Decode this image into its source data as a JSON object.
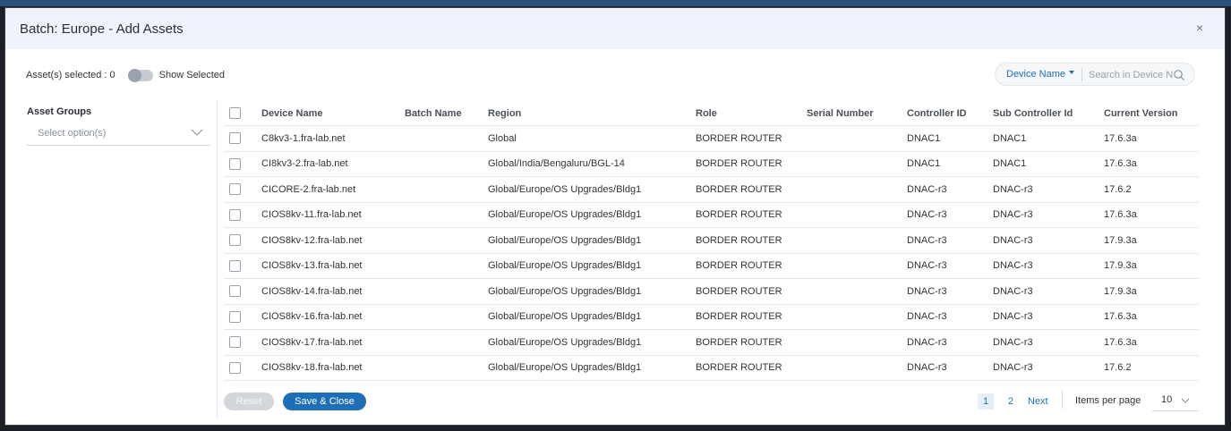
{
  "modal": {
    "title": "Batch: Europe - Add Assets",
    "close": "×"
  },
  "selection": {
    "count_label": "Asset(s) selected : 0",
    "toggle_label": "Show Selected",
    "toggle_on": false
  },
  "search": {
    "field": "Device Name",
    "placeholder": "Search in Device Na"
  },
  "asset_groups": {
    "title": "Asset Groups",
    "placeholder": "Select option(s)"
  },
  "table": {
    "columns": [
      "Device Name",
      "Batch Name",
      "Region",
      "Role",
      "Serial Number",
      "Controller ID",
      "Sub Controller Id",
      "Current Version"
    ],
    "rows": [
      {
        "device": "C8kv3-1.fra-lab.net",
        "batch": "",
        "region": "Global",
        "role": "BORDER ROUTER",
        "serial": "",
        "controller": "DNAC1",
        "sub": "DNAC1",
        "version": "17.6.3a"
      },
      {
        "device": "CI8kv3-2.fra-lab.net",
        "batch": "",
        "region": "Global/India/Bengaluru/BGL-14",
        "role": "BORDER ROUTER",
        "serial": "",
        "controller": "DNAC1",
        "sub": "DNAC1",
        "version": "17.6.3a"
      },
      {
        "device": "CICORE-2.fra-lab.net",
        "batch": "",
        "region": "Global/Europe/OS Upgrades/Bldg1",
        "role": "BORDER ROUTER",
        "serial": "",
        "controller": "DNAC-r3",
        "sub": "DNAC-r3",
        "version": "17.6.2"
      },
      {
        "device": "CIOS8kv-11.fra-lab.net",
        "batch": "",
        "region": "Global/Europe/OS Upgrades/Bldg1",
        "role": "BORDER ROUTER",
        "serial": "",
        "controller": "DNAC-r3",
        "sub": "DNAC-r3",
        "version": "17.6.3a"
      },
      {
        "device": "CIOS8kv-12.fra-lab.net",
        "batch": "",
        "region": "Global/Europe/OS Upgrades/Bldg1",
        "role": "BORDER ROUTER",
        "serial": "",
        "controller": "DNAC-r3",
        "sub": "DNAC-r3",
        "version": "17.9.3a"
      },
      {
        "device": "CIOS8kv-13.fra-lab.net",
        "batch": "",
        "region": "Global/Europe/OS Upgrades/Bldg1",
        "role": "BORDER ROUTER",
        "serial": "",
        "controller": "DNAC-r3",
        "sub": "DNAC-r3",
        "version": "17.9.3a"
      },
      {
        "device": "CIOS8kv-14.fra-lab.net",
        "batch": "",
        "region": "Global/Europe/OS Upgrades/Bldg1",
        "role": "BORDER ROUTER",
        "serial": "",
        "controller": "DNAC-r3",
        "sub": "DNAC-r3",
        "version": "17.9.3a"
      },
      {
        "device": "CIOS8kv-16.fra-lab.net",
        "batch": "",
        "region": "Global/Europe/OS Upgrades/Bldg1",
        "role": "BORDER ROUTER",
        "serial": "",
        "controller": "DNAC-r3",
        "sub": "DNAC-r3",
        "version": "17.6.3a"
      },
      {
        "device": "CIOS8kv-17.fra-lab.net",
        "batch": "",
        "region": "Global/Europe/OS Upgrades/Bldg1",
        "role": "BORDER ROUTER",
        "serial": "",
        "controller": "DNAC-r3",
        "sub": "DNAC-r3",
        "version": "17.6.3a"
      },
      {
        "device": "CIOS8kv-18.fra-lab.net",
        "batch": "",
        "region": "Global/Europe/OS Upgrades/Bldg1",
        "role": "BORDER ROUTER",
        "serial": "",
        "controller": "DNAC-r3",
        "sub": "DNAC-r3",
        "version": "17.6.2"
      }
    ]
  },
  "footer": {
    "reset_label": "Reset",
    "save_label": "Save & Close",
    "pages": [
      "1",
      "2"
    ],
    "current_page": "1",
    "next_label": "Next",
    "items_per_page_label": "Items per page",
    "items_per_page": "10"
  },
  "colors": {
    "accent": "#1e6fb7",
    "header_bg": "#eef4fa",
    "disabled": "#d3d7dc"
  }
}
